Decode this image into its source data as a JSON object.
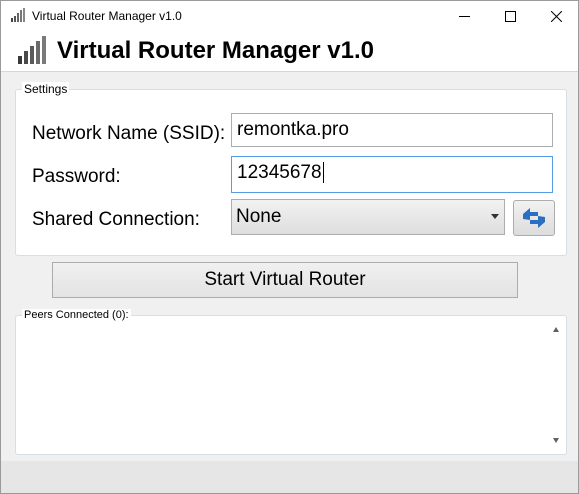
{
  "window": {
    "title": "Virtual Router Manager v1.0",
    "minimize_glyph": "—",
    "maximize_glyph": "☐",
    "close_glyph": "✕",
    "app_icon": "signal-bars-icon"
  },
  "header": {
    "title": "Virtual Router Manager v1.0",
    "icon": "signal-bars-icon"
  },
  "settings": {
    "legend": "Settings",
    "ssid_label": "Network Name (SSID):",
    "ssid_value": "remontka.pro",
    "password_label": "Password:",
    "password_value": "12345678",
    "shared_label": "Shared Connection:",
    "shared_value": "None",
    "refresh_icon": "refresh-arrows-icon"
  },
  "actions": {
    "start_label": "Start Virtual Router"
  },
  "peers": {
    "legend": "Peers Connected (0):",
    "items": []
  },
  "colors": {
    "focus_border": "#569de5",
    "icon_blue": "#2b6fc2",
    "content_bg": "#f0f0f0"
  }
}
